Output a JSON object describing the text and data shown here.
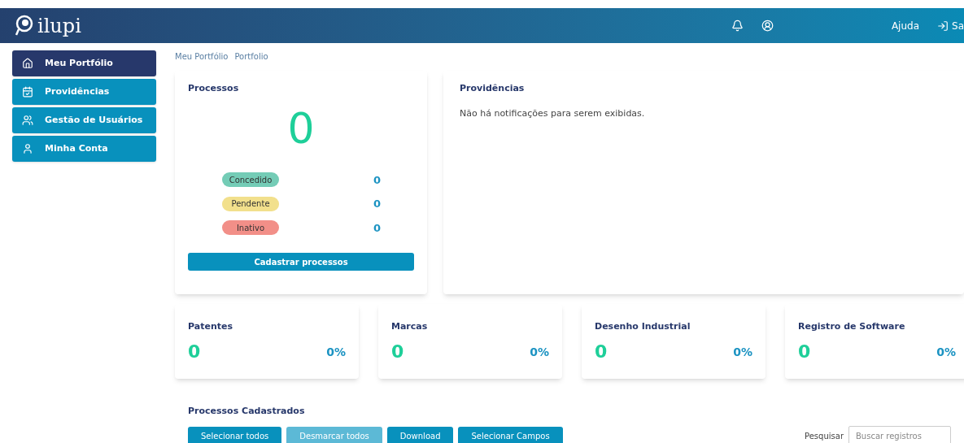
{
  "header": {
    "logo": "ilupi",
    "help": "Ajuda",
    "logout": "Sa"
  },
  "sidebar": {
    "items": [
      {
        "label": "Meu Portfólio",
        "selected": true
      },
      {
        "label": "Providências",
        "selected": false
      },
      {
        "label": "Gestão de Usuários",
        "selected": false
      },
      {
        "label": "Minha Conta",
        "selected": false
      }
    ]
  },
  "breadcrumb": [
    "Meu Portfólio",
    "Portfolio"
  ],
  "processes": {
    "title": "Processos",
    "total": "0",
    "statuses": [
      {
        "label": "Concedido",
        "count": "0",
        "color": "#74ccb6"
      },
      {
        "label": "Pendente",
        "count": "0",
        "color": "#f2e08c"
      },
      {
        "label": "Inativo",
        "count": "0",
        "color": "#f28f88"
      }
    ],
    "button": "Cadastrar processos"
  },
  "notices": {
    "title": "Providências",
    "message": "Não há notificações para serem exibidas."
  },
  "stats": [
    {
      "title": "Patentes",
      "count": "0",
      "percent": "0%"
    },
    {
      "title": "Marcas",
      "count": "0",
      "percent": "0%"
    },
    {
      "title": "Desenho Industrial",
      "count": "0",
      "percent": "0%"
    },
    {
      "title": "Registro de Software",
      "count": "0",
      "percent": "0%"
    }
  ],
  "registered": {
    "title": "Processos Cadastrados",
    "buttons": [
      {
        "label": "Selecionar todos",
        "disabled": false
      },
      {
        "label": "Desmarcar todos",
        "disabled": true
      },
      {
        "label": "Download",
        "disabled": false
      },
      {
        "label": "Selecionar Campos",
        "disabled": false
      }
    ],
    "search_label": "Pesquisar",
    "search": {
      "placeholder": "Buscar registros"
    }
  }
}
